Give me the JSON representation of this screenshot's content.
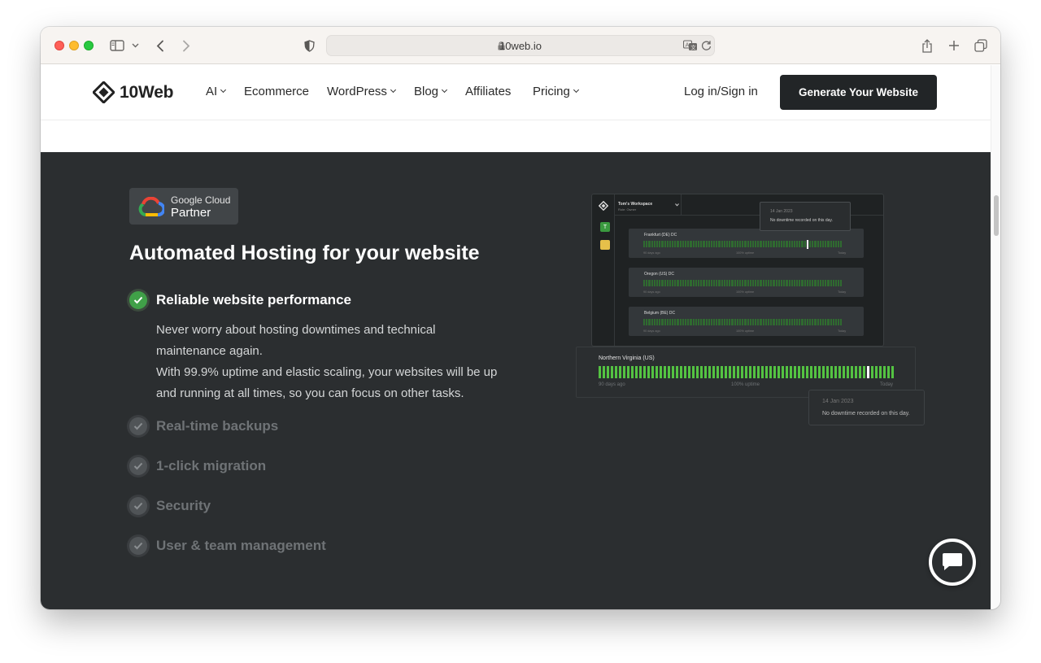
{
  "browser": {
    "url": "10web.io",
    "icons": [
      "sidebar-icon",
      "back-icon",
      "forward-icon",
      "shield-icon",
      "lock-icon",
      "translate-icon",
      "reload-icon",
      "share-icon",
      "new-tab-icon",
      "tabs-icon"
    ]
  },
  "nav": {
    "logo_text": "10Web",
    "items": [
      {
        "label": "AI",
        "has_dropdown": true
      },
      {
        "label": "Ecommerce",
        "has_dropdown": false
      },
      {
        "label": "WordPress",
        "has_dropdown": true
      },
      {
        "label": "Blog",
        "has_dropdown": true
      },
      {
        "label": "Affiliates",
        "has_dropdown": false
      },
      {
        "label": "Pricing",
        "has_dropdown": true
      }
    ],
    "login": "Log in/Sign in",
    "cta": "Generate Your Website"
  },
  "hero": {
    "badge_top": "Google Cloud",
    "badge_bottom": "Partner",
    "title": "Automated Hosting for your website",
    "features": [
      {
        "label": "Reliable website performance",
        "active": true
      },
      {
        "label": "Real-time backups",
        "active": false
      },
      {
        "label": "1-click migration",
        "active": false
      },
      {
        "label": "Security",
        "active": false
      },
      {
        "label": "User & team management",
        "active": false
      }
    ],
    "description": [
      "Never worry about hosting downtimes and technical maintenance again.",
      "With 99.9% uptime and elastic scaling, your websites will be up and running at all times, so you can focus on other tasks."
    ]
  },
  "dashboard": {
    "workspace": "Tom's Workspace",
    "role": "Role: Owner",
    "sidebar_badge": "T",
    "cards": [
      {
        "title": "Frankfurt (DE) DC"
      },
      {
        "title": "Oregon (US) DC"
      },
      {
        "title": "Belgium (BE) DC"
      }
    ],
    "card_foot": {
      "left": "90 days ago",
      "center": "100% uptime",
      "right": "Today"
    },
    "tooltip": {
      "date": "14 Jan 2023",
      "text": "No downtime recorded on this day."
    },
    "highlight": {
      "title": "Northern Virginia (US)",
      "foot_left": "90 days ago",
      "foot_center": "100% uptime",
      "foot_right": "Today"
    }
  },
  "colors": {
    "dark_bg": "#2b2e30",
    "accent_green": "#40a048",
    "bar_green": "#54c342"
  }
}
